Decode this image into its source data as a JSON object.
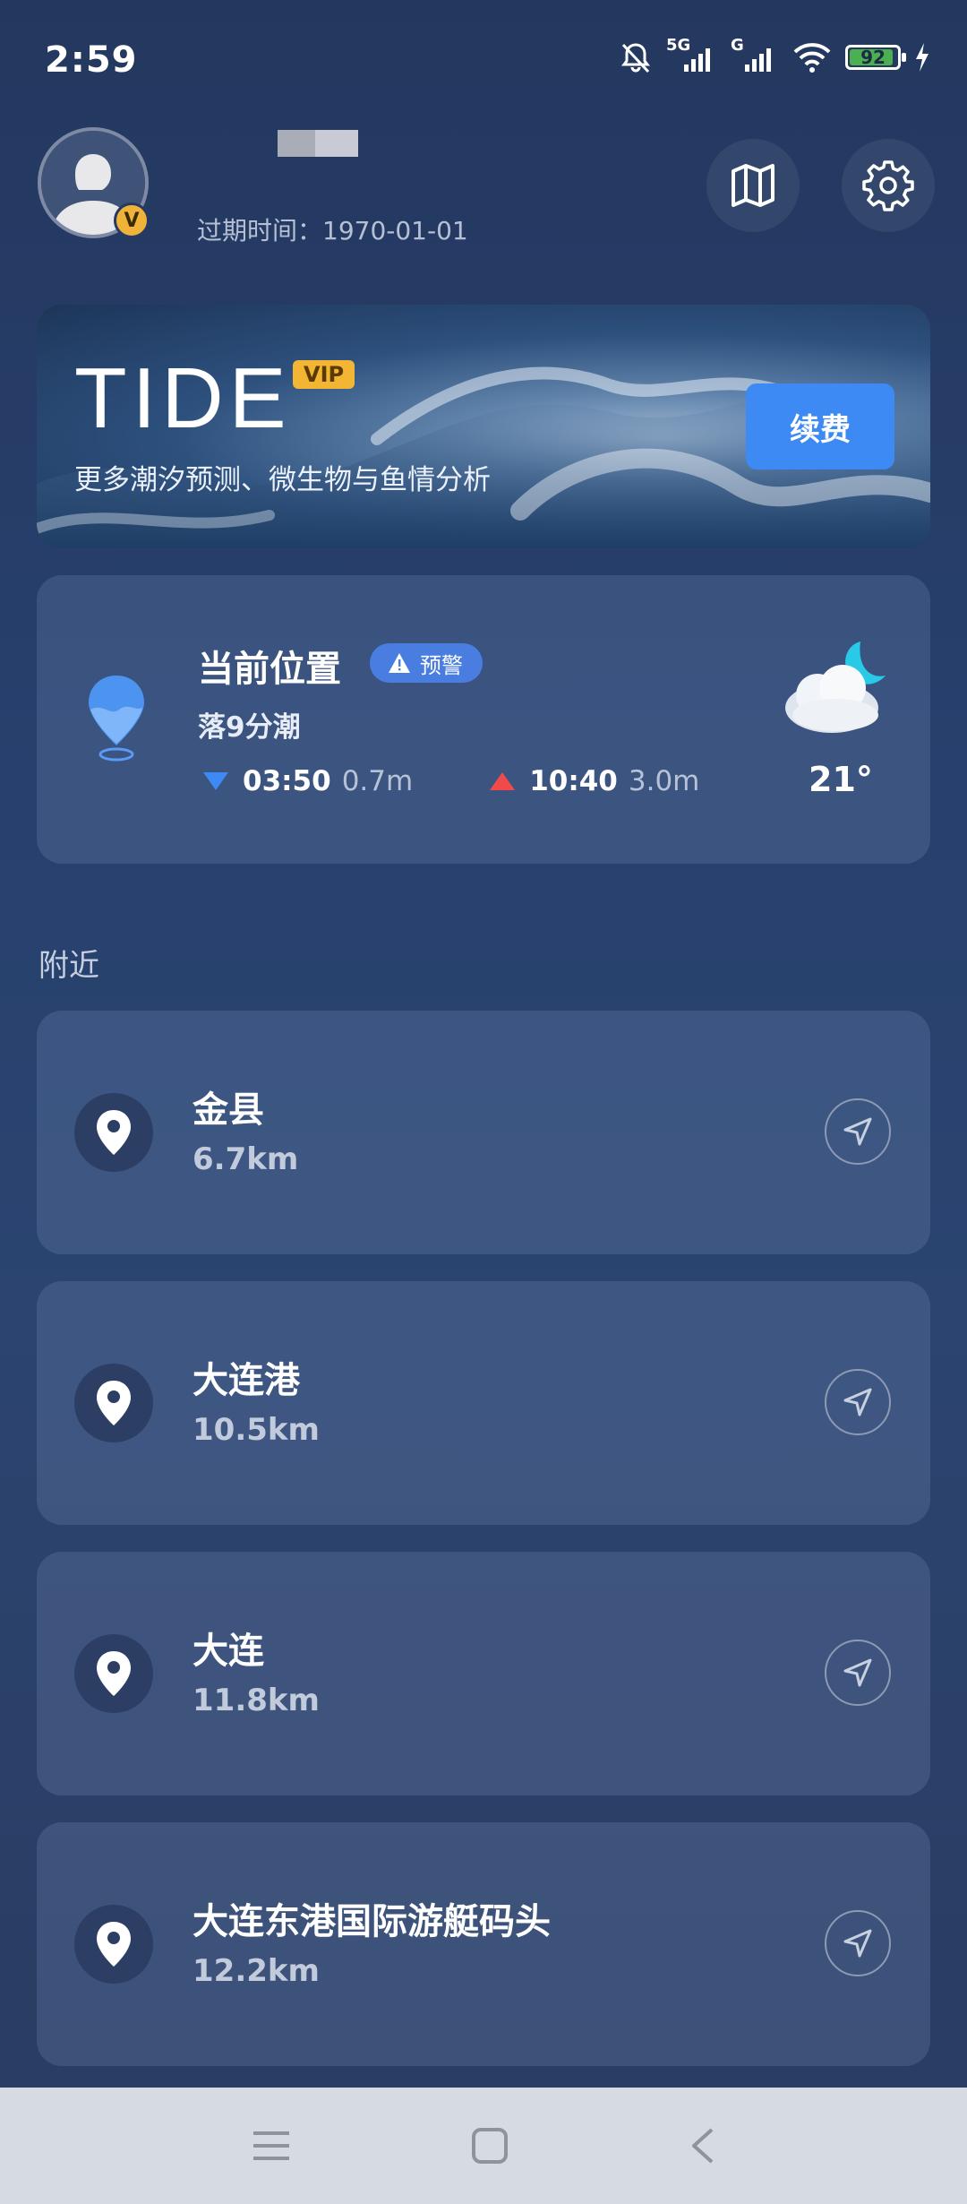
{
  "status_bar": {
    "time": "2:59",
    "network_1": "5G",
    "network_2": "G",
    "battery": "92",
    "icons": [
      "mute-bell-icon",
      "signal-icon",
      "signal-icon",
      "wifi-icon",
      "battery-icon",
      "charging-icon"
    ]
  },
  "header": {
    "expire_text": "过期时间：1970-01-01",
    "badge_letter": "V",
    "icons": [
      "map-icon",
      "gear-icon"
    ]
  },
  "banner": {
    "title": "TIDE",
    "vip_label": "VIP",
    "subtitle": "更多潮汐预测、微生物与鱼情分析",
    "renew_label": "续费"
  },
  "current_location": {
    "title": "当前位置",
    "warning_label": "预警",
    "tide_status": "落9分潮",
    "low_tide_time": "03:50",
    "low_tide_height": "0.7m",
    "high_tide_time": "10:40",
    "high_tide_height": "3.0m",
    "temperature": "21°",
    "weather_icon": "cloudy-night-icon"
  },
  "nearby": {
    "section_label": "附近",
    "items": [
      {
        "name": "金县",
        "distance": "6.7km"
      },
      {
        "name": "大连港",
        "distance": "10.5km"
      },
      {
        "name": "大连",
        "distance": "11.8km"
      },
      {
        "name": "大连东港国际游艇码头",
        "distance": "12.2km"
      }
    ]
  },
  "colors": {
    "accent": "#3d8af4",
    "vip_gold": "#f2b534",
    "low_tide": "#3d8af4",
    "high_tide": "#f04a4a",
    "background": "#27406d"
  }
}
